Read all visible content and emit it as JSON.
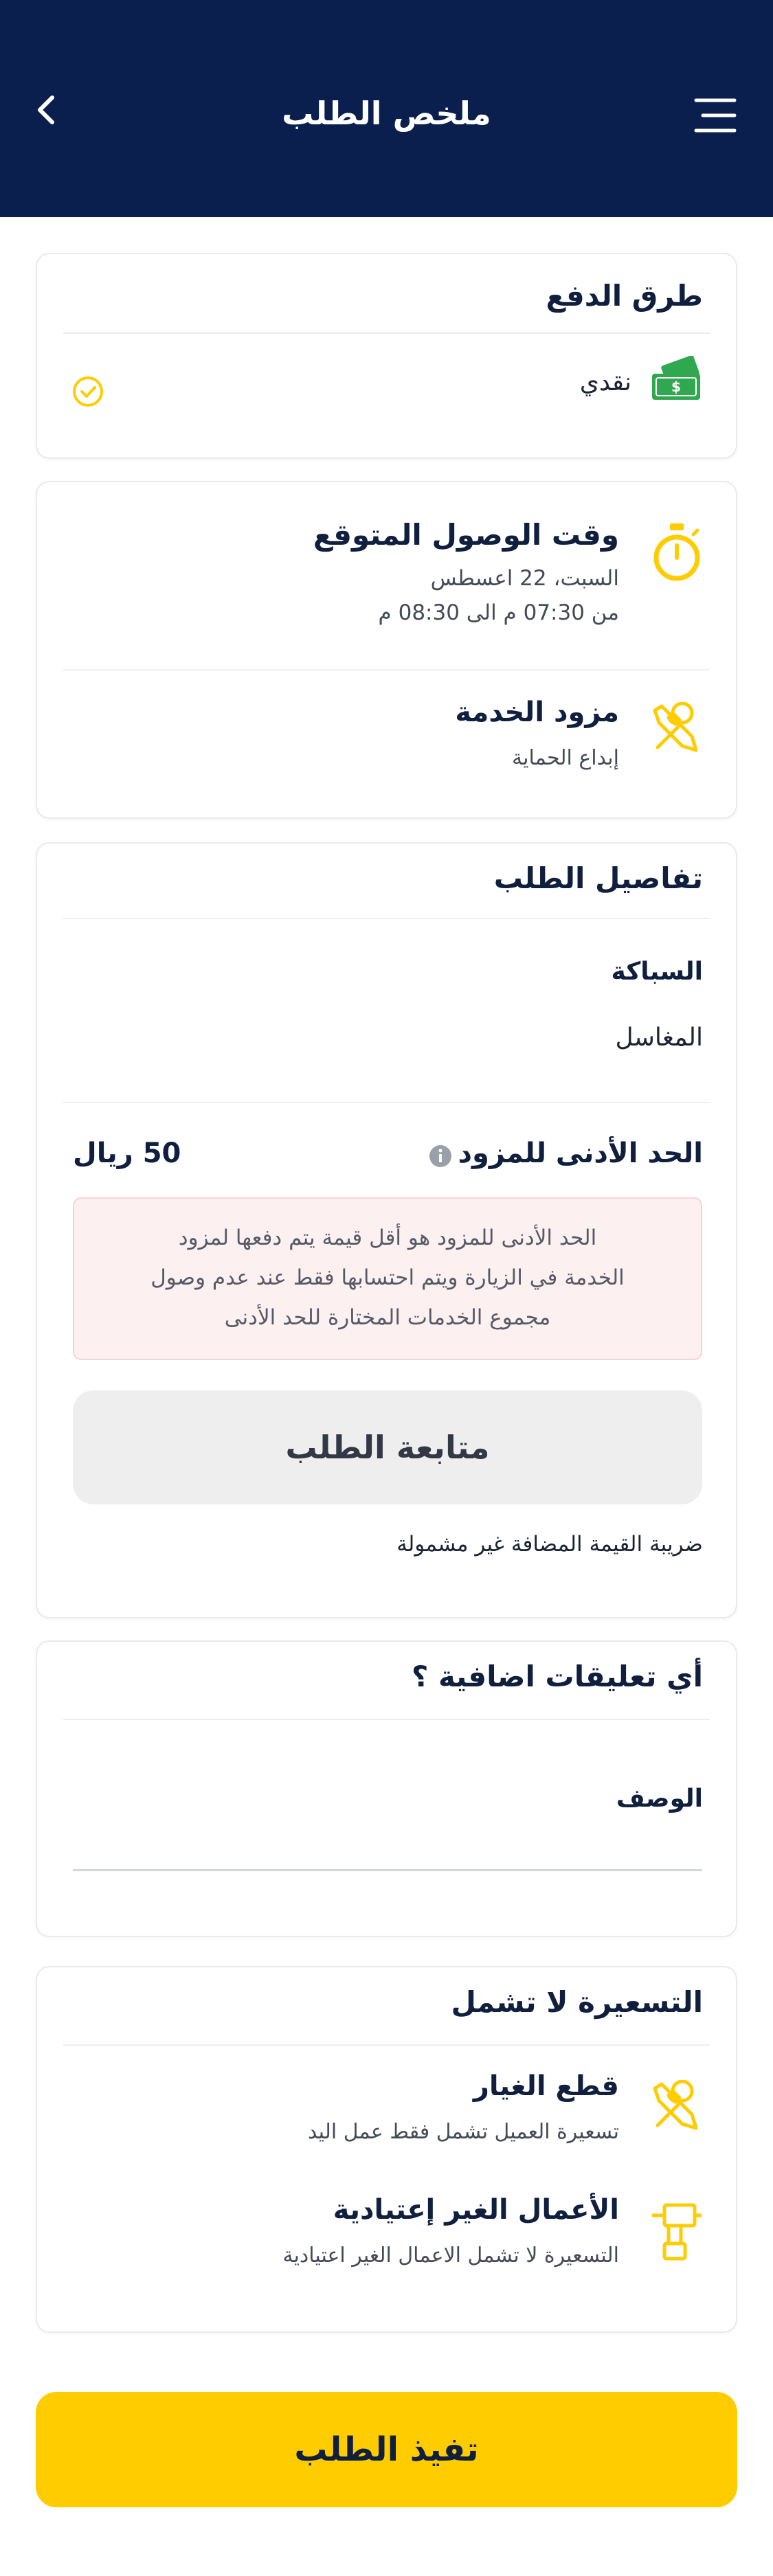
{
  "header": {
    "title": "ملخص الطلب",
    "bg_color": "#0a1f4e"
  },
  "payment": {
    "title": "طرق الدفع",
    "method_label": "نقدي",
    "method_icon": "cash-icon",
    "selected_icon": "check-circle-icon"
  },
  "arrival": {
    "title": "وقت الوصول المتوقع",
    "date": "السبت، 22 اعسطس",
    "time_range": "من 07:30 م  الى  08:30 م",
    "icon": "stopwatch-icon"
  },
  "provider": {
    "title": "مزود الخدمة",
    "name": "إبداع الحماية",
    "icon": "tools-icon"
  },
  "details": {
    "title": "تفاصيل الطلب",
    "category": "السباكة",
    "service": "المغاسل",
    "min_label": "الحد الأدنى للمزود",
    "min_value": "50 ريال",
    "min_note_line1": "الحد الأدنى للمزود هو أقل قيمة يتم دفعها لمزود",
    "min_note_line2": "الخدمة في الزيارة ويتم احتسابها فقط عند عدم وصول",
    "min_note_line3": "مجموع الخدمات المختارة للحد الأدنى",
    "follow_button": "متابعة الطلب",
    "vat_note": "ضريبة القيمة المضافة غير مشمولة"
  },
  "comments": {
    "title": "أي تعليقات اضافية ؟",
    "description_label": "الوصف",
    "description_value": ""
  },
  "pricing": {
    "title": "التسعيرة لا تشمل",
    "items": [
      {
        "title": "قطع الغيار",
        "subtitle": "تسعيرة العميل تشمل فقط عمل اليد",
        "icon": "tools-icon"
      },
      {
        "title": "الأعمال الغير إعتيادية",
        "subtitle": "التسعيرة لا تشمل الاعمال الغير اعتيادية",
        "icon": "drill-icon"
      }
    ]
  },
  "submit_button": "تفيذ الطلب",
  "colors": {
    "accent": "#ffcc00",
    "navy": "#0a1f4e",
    "cash_green": "#2fa84f"
  }
}
